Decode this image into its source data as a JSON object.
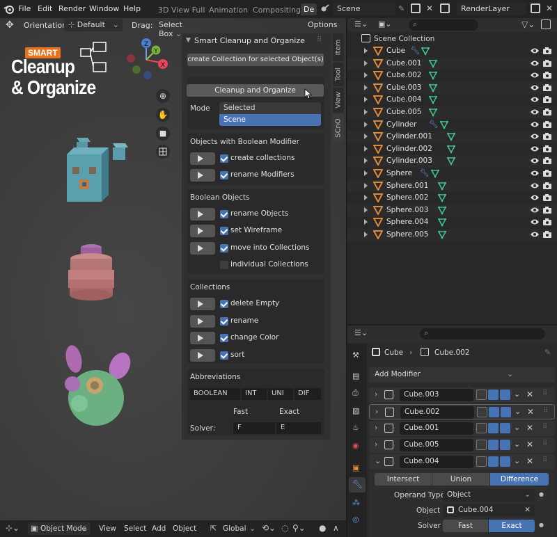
{
  "topbar": {
    "menus": [
      "File",
      "Edit",
      "Render",
      "Window",
      "Help"
    ],
    "workspaces": [
      "3D View Full",
      "Animation",
      "Compositing",
      "De"
    ],
    "scene": "Scene",
    "view_layer": "RenderLayer"
  },
  "viewport": {
    "orientation_label": "Orientation:",
    "orientation_value": "Default",
    "drag_label": "Drag:",
    "drag_value": "Select Box",
    "options_label": "Options",
    "logo_small": "SMART",
    "logo_line1": "Cleanup",
    "logo_line2": "& Organize",
    "gizmo_axes": [
      "Z",
      "Y",
      "X"
    ]
  },
  "npanel": {
    "header": "Smart Cleanup and Organize",
    "create_collection_btn": "create Collection for selected Object(s)",
    "cleanup_btn": "Cleanup and Organize",
    "mode_label": "Mode",
    "mode_options": [
      "Selected",
      "Scene"
    ],
    "mode_selected": "Scene",
    "sections": {
      "boolean_modifier": {
        "title": "Objects with Boolean Modifier",
        "rows": [
          {
            "label": "create collections",
            "checked": true
          },
          {
            "label": "rename Modifiers",
            "checked": true
          }
        ]
      },
      "boolean_objects": {
        "title": "Boolean Objects",
        "rows": [
          {
            "label": "rename Objects",
            "checked": true
          },
          {
            "label": "set Wireframe",
            "checked": true
          },
          {
            "label": "move into Collections",
            "checked": true
          },
          {
            "label": "individual Collections",
            "checked": false
          }
        ]
      },
      "collections": {
        "title": "Collections",
        "rows": [
          {
            "label": "delete Empty",
            "checked": true
          },
          {
            "label": "rename",
            "checked": true
          },
          {
            "label": "change Color",
            "checked": true
          },
          {
            "label": "sort",
            "checked": true
          }
        ]
      },
      "abbreviations": {
        "title": "Abbreviations",
        "fields": [
          "BOOLEAN",
          "INT",
          "UNI",
          "DIF"
        ],
        "fast_label": "Fast",
        "exact_label": "Exact",
        "solver_label": "Solver:",
        "solver_fast": "F",
        "solver_exact": "E"
      }
    },
    "vtabs": [
      "Item",
      "Tool",
      "View",
      "SCnO"
    ]
  },
  "outliner": {
    "root": "Scene Collection",
    "items": [
      {
        "name": "Cube",
        "wrench": true
      },
      {
        "name": "Cube.001",
        "wrench": false
      },
      {
        "name": "Cube.002",
        "wrench": false
      },
      {
        "name": "Cube.003",
        "wrench": false
      },
      {
        "name": "Cube.004",
        "wrench": false
      },
      {
        "name": "Cube.005",
        "wrench": false
      },
      {
        "name": "Cylinder",
        "wrench": true
      },
      {
        "name": "Cylinder.001",
        "wrench": false
      },
      {
        "name": "Cylinder.002",
        "wrench": false
      },
      {
        "name": "Cylinder.003",
        "wrench": false
      },
      {
        "name": "Sphere",
        "wrench": true
      },
      {
        "name": "Sphere.001",
        "wrench": false
      },
      {
        "name": "Sphere.002",
        "wrench": false
      },
      {
        "name": "Sphere.003",
        "wrench": false
      },
      {
        "name": "Sphere.004",
        "wrench": false
      },
      {
        "name": "Sphere.005",
        "wrench": false
      }
    ]
  },
  "properties": {
    "breadcrumb_object": "Cube",
    "breadcrumb_mesh": "Cube.002",
    "add_modifier": "Add Modifier",
    "modifiers": [
      "Cube.003",
      "Cube.002",
      "Cube.001",
      "Cube.005",
      "Cube.004"
    ],
    "ops": [
      "Intersect",
      "Union",
      "Difference"
    ],
    "op_selected": "Difference",
    "operand_type_label": "Operand Type",
    "operand_type_value": "Object",
    "object_label": "Object",
    "object_value": "Cube.004",
    "solver_label": "Solver",
    "solver_options": [
      "Fast",
      "Exact"
    ],
    "solver_selected": "Exact"
  },
  "statusbar": {
    "mode": "Object Mode",
    "menus": [
      "View",
      "Select",
      "Add",
      "Object"
    ],
    "transform": "Global"
  },
  "colors": {
    "accent_blue": "#4772b3",
    "object_orange": "#e0893a",
    "mesh_green": "#3fc48c",
    "logo_orange": "#e8731f"
  }
}
